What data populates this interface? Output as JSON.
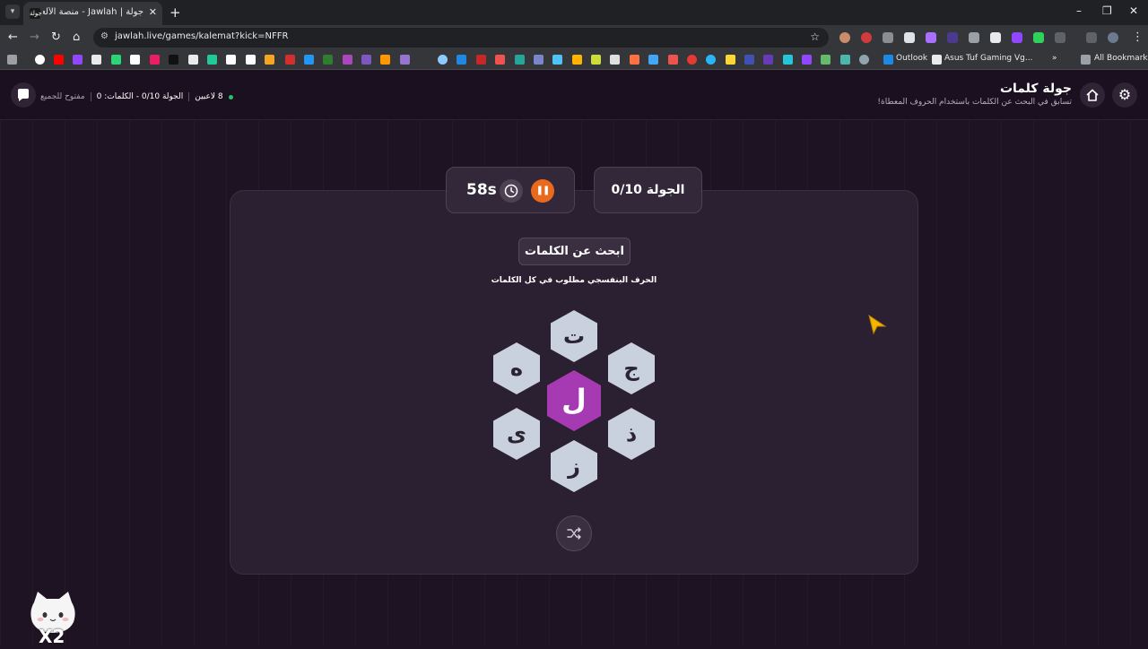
{
  "browser": {
    "tab_title": "جولة | Jawlah - منصة الألعاب الـ...",
    "tab_favicon_text": "جولة",
    "url": "jawlah.live/games/kalemat?kick=NFFR",
    "bookmarks": [
      {
        "label": "Outlook"
      },
      {
        "label": "Asus Tuf Gaming Vg..."
      },
      {
        "label": "All Bookmarks"
      }
    ]
  },
  "header": {
    "title": "جولة كلمات",
    "subtitle": "تسابق في البحث عن الكلمات باستخدام الحروف المعطاة!",
    "players": "8 لاعبين",
    "round_words": "الجولة 0/10 - الكلمات: 0",
    "access": "مفتوح للجميع"
  },
  "game": {
    "timer": "58s",
    "round": "الجولة 0/10",
    "instruction": "ابحث عن الكلمات",
    "hint": "الحرف البنفسجي مطلوب في كل الكلمات",
    "center_letter": "ل",
    "outer_letters": [
      "ت",
      "ج",
      "ذ",
      "ز",
      "ى",
      "ه"
    ]
  },
  "mascot_text": "X2",
  "colors": {
    "accent_purple": "#a63ab2",
    "pause_orange": "#e96a1d",
    "hex_tile": "#c9d1de",
    "online_green": "#22c55e"
  }
}
